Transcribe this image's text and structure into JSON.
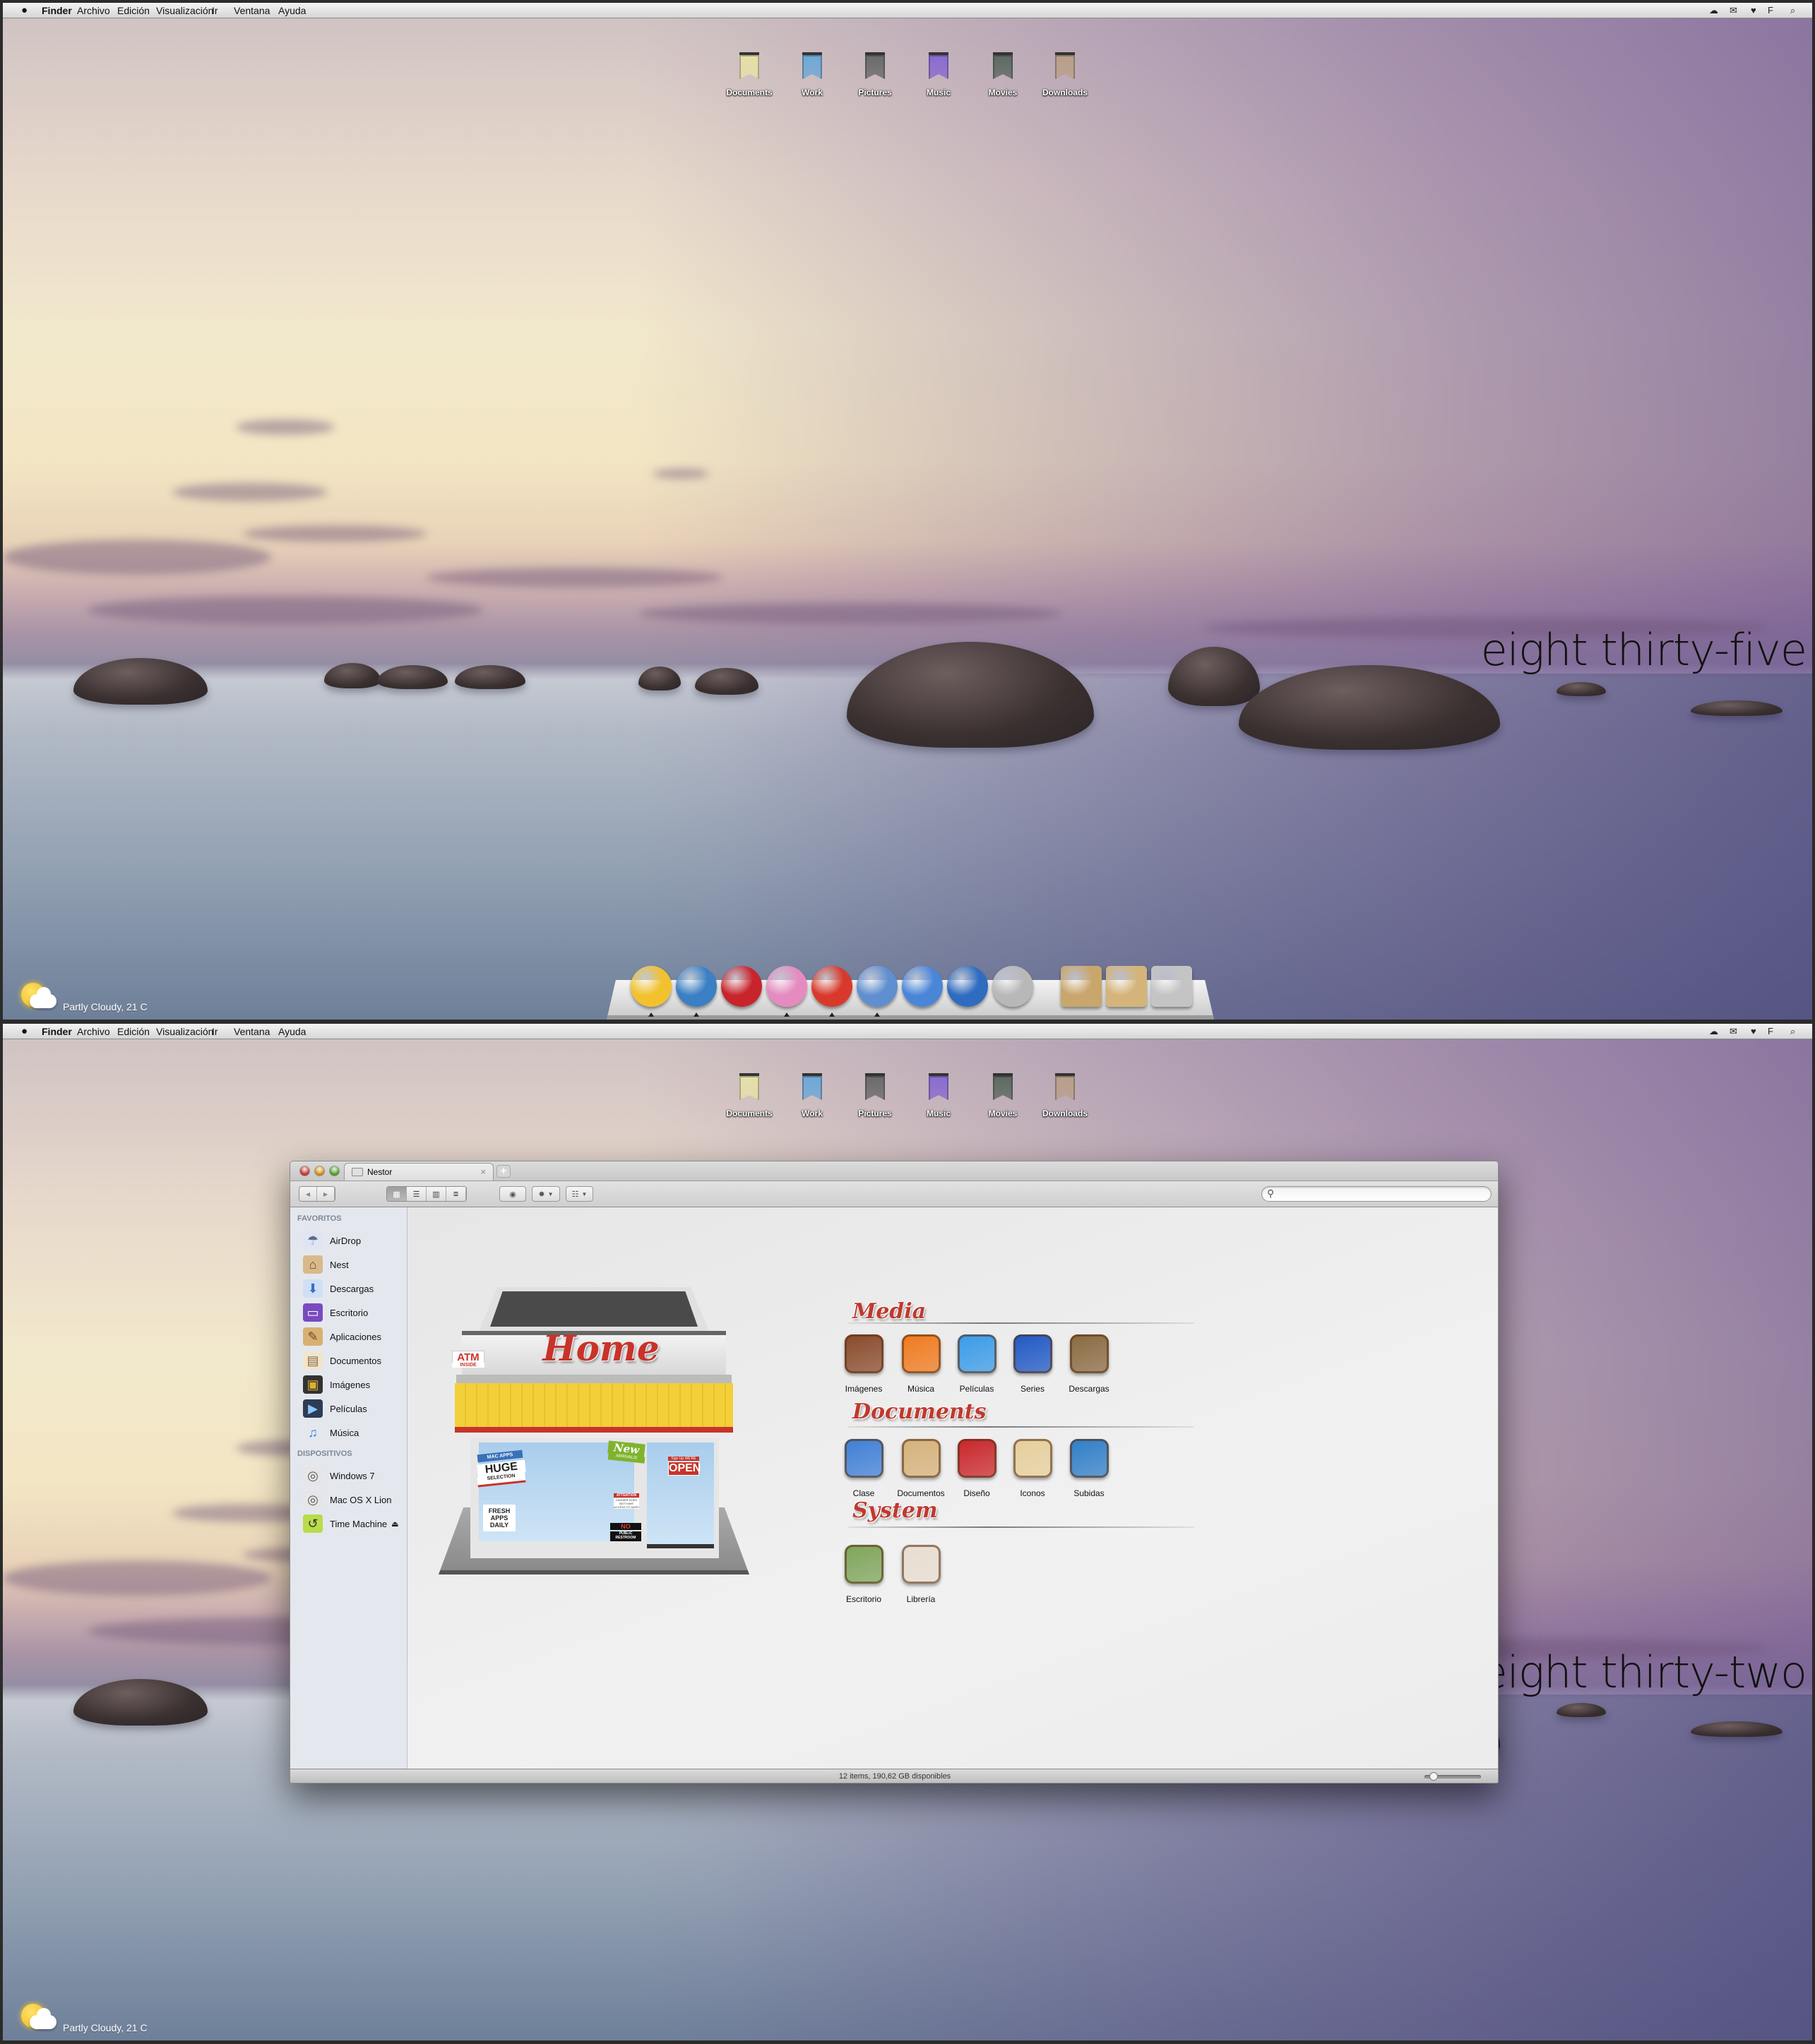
{
  "menubar": {
    "apple_icon": "apple-icon",
    "items": [
      "Finder",
      "Archivo",
      "Edición",
      "Visualización",
      "Ir",
      "Ventana",
      "Ayuda"
    ],
    "status_icons": [
      "cloud-icon",
      "mail-icon",
      "heart-icon",
      "facebook-icon",
      "search-icon"
    ]
  },
  "desktop_icons": [
    {
      "label": "Documents",
      "icon": "documents-ribbon-icon",
      "color": "#e6e0a8"
    },
    {
      "label": "Work",
      "icon": "work-ribbon-icon",
      "color": "#6fa8d6"
    },
    {
      "label": "Pictures",
      "icon": "pictures-ribbon-icon",
      "color": "#6b6b6b"
    },
    {
      "label": "Music",
      "icon": "music-ribbon-icon",
      "color": "#8a6bd0"
    },
    {
      "label": "Movies",
      "icon": "movies-ribbon-icon",
      "color": "#5e6a62"
    },
    {
      "label": "Downloads",
      "icon": "downloads-ribbon-icon",
      "color": "#b9a08a"
    }
  ],
  "screens": [
    {
      "clock": "eight thirty-five"
    },
    {
      "clock": "eight thirty-two"
    }
  ],
  "weather": {
    "text": "Partly Cloudy, 21 C",
    "icon": "partly-cloudy-icon"
  },
  "dock": {
    "items": [
      {
        "icon": "screaming-face-app-icon",
        "color": "#f2c12e",
        "running": true
      },
      {
        "icon": "safari-compass-icon",
        "color": "#3b7fc4",
        "running": true
      },
      {
        "icon": "captain-america-shield-icon",
        "color": "#c8242c",
        "running": false
      },
      {
        "icon": "rainbow-orb-icon",
        "color": "#e58bc0",
        "running": true
      },
      {
        "icon": "mail-airplane-icon",
        "color": "#d8392b",
        "running": true
      },
      {
        "icon": "blueprint-icon",
        "color": "#5f8fd0",
        "running": true
      },
      {
        "icon": "xcode-iphone-icon",
        "color": "#4a86d8",
        "running": false
      },
      {
        "icon": "globe-sync-icon",
        "color": "#2f6cc0",
        "running": false
      },
      {
        "icon": "system-preferences-gear-icon",
        "color": "#b8b8b8",
        "running": false
      },
      {
        "icon": "applications-stack-icon",
        "color": "#c9a66b",
        "running": false
      },
      {
        "icon": "documents-stack-icon",
        "color": "#d4b47a",
        "running": false
      },
      {
        "icon": "trash-icon",
        "color": "#c4c4c4",
        "running": false
      }
    ]
  },
  "finder": {
    "tab_title": "Nestor",
    "view_modes": [
      "icon-view",
      "list-view",
      "column-view",
      "cover-flow-view"
    ],
    "selected_view": "icon-view",
    "sidebar": [
      {
        "heading": "FAVORITOS",
        "items": [
          {
            "label": "AirDrop",
            "icon": "airdrop-icon"
          },
          {
            "label": "Nest",
            "icon": "home-icon"
          },
          {
            "label": "Descargas",
            "icon": "downloads-icon"
          },
          {
            "label": "Escritorio",
            "icon": "desktop-icon"
          },
          {
            "label": "Aplicaciones",
            "icon": "applications-icon"
          },
          {
            "label": "Documentos",
            "icon": "documents-icon"
          },
          {
            "label": "Imágenes",
            "icon": "pictures-icon"
          },
          {
            "label": "Películas",
            "icon": "movies-icon"
          },
          {
            "label": "Música",
            "icon": "music-icon"
          }
        ]
      },
      {
        "heading": "DISPOSITIVOS",
        "items": [
          {
            "label": "Windows 7",
            "icon": "hard-drive-icon"
          },
          {
            "label": "Mac OS X Lion",
            "icon": "hard-drive-icon"
          },
          {
            "label": "Time Machine",
            "icon": "time-machine-icon",
            "eject": true
          }
        ]
      }
    ],
    "store_sign": {
      "title": "Home",
      "atm": "ATM",
      "atm_sub": "INSIDE",
      "poster1_top": "MAC APPS",
      "poster1_main": "HUGE",
      "poster1_sub": "SELECTION",
      "poster2": "FRESH APPS DAILY",
      "new_sign": "New",
      "new_sub": "ARRIVALS!",
      "open_top": "Sign Up WE'RE",
      "open": "OPEN",
      "attention": "ATTENTION",
      "attention_sub": "CASHIER DOES NOT HAVE ACCESS TO SAFE!",
      "restroom_no": "NO",
      "restroom": "PUBLIC RESTROOM"
    },
    "sections": [
      {
        "title": "Media",
        "items": [
          {
            "label": "Imágenes",
            "icon": "pictures-folder-icon",
            "color": "#8a4a2a"
          },
          {
            "label": "Música",
            "icon": "music-folder-icon",
            "color": "#f07a1e"
          },
          {
            "label": "Películas",
            "icon": "movies-folder-icon",
            "color": "#3a9be8"
          },
          {
            "label": "Series",
            "icon": "series-folder-icon",
            "color": "#1f58c4"
          },
          {
            "label": "Descargas",
            "icon": "downloads-crate-icon",
            "color": "#8a6a40"
          }
        ]
      },
      {
        "title": "Documents",
        "items": [
          {
            "label": "Clase",
            "icon": "blueprint-folder-icon",
            "color": "#3f7fd6"
          },
          {
            "label": "Documentos",
            "icon": "clipboard-folder-icon",
            "color": "#d6b27a"
          },
          {
            "label": "Diseño",
            "icon": "toolbox-folder-icon",
            "color": "#c9262a"
          },
          {
            "label": "Iconos",
            "icon": "compass-folder-icon",
            "color": "#e6cf9c"
          },
          {
            "label": "Subidas",
            "icon": "globe-compass-folder-icon",
            "color": "#2f7ec8"
          }
        ]
      },
      {
        "title": "System",
        "items": [
          {
            "label": "Escritorio",
            "icon": "theater-desktop-icon",
            "color": "#7ea55a"
          },
          {
            "label": "Librería",
            "icon": "book-icon",
            "color": "#e8ddd0"
          }
        ]
      }
    ],
    "status_text": "12 items, 190,62 GB disponibles",
    "icon_size_slider": 0.1
  }
}
